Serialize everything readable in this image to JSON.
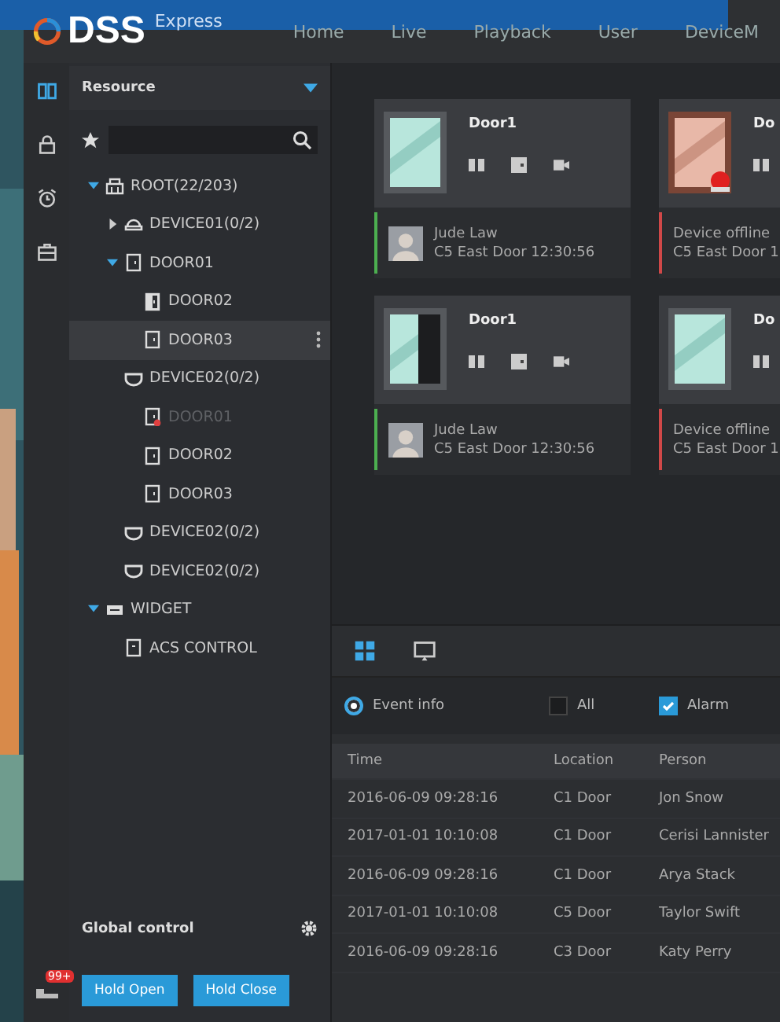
{
  "header": {
    "logo": "DSS",
    "edition": "Express",
    "nav": [
      {
        "label": "Home"
      },
      {
        "label": "Live"
      },
      {
        "label": "Playback"
      },
      {
        "label": "User"
      },
      {
        "label": "DeviceM"
      }
    ]
  },
  "rail": [
    {
      "kind": "book",
      "selected": true
    },
    {
      "kind": "lock",
      "selected": false
    },
    {
      "kind": "alarm",
      "selected": false
    },
    {
      "kind": "briefcase",
      "selected": false
    }
  ],
  "rail_badge": "99+",
  "sidebar": {
    "title": "Resource",
    "tree": [
      {
        "label": "ROOT(22/203)",
        "kind": "root",
        "expanded": true,
        "selected": false,
        "offline": false,
        "children": [
          {
            "label": "DEVICE01(0/2)",
            "kind": "device",
            "expanded": false,
            "selected": false,
            "offline": false
          },
          {
            "label": "DOOR01",
            "kind": "door",
            "expanded": true,
            "selected": false,
            "offline": false,
            "children": [
              {
                "label": "DOOR02",
                "kind": "door-open",
                "selected": false,
                "offline": false
              },
              {
                "label": "DOOR03",
                "kind": "door",
                "selected": true,
                "offline": false
              }
            ]
          },
          {
            "label": "DEVICE02(0/2)",
            "kind": "device2",
            "selected": false,
            "offline": false,
            "children": [
              {
                "label": "DOOR01",
                "kind": "door",
                "selected": false,
                "offline": true
              },
              {
                "label": "DOOR02",
                "kind": "door",
                "selected": false,
                "offline": false
              },
              {
                "label": "DOOR03",
                "kind": "door",
                "selected": false,
                "offline": false
              }
            ]
          },
          {
            "label": "DEVICE02(0/2)",
            "kind": "device2",
            "selected": false,
            "offline": false
          },
          {
            "label": "DEVICE02(0/2)",
            "kind": "device2",
            "selected": false,
            "offline": false
          }
        ]
      },
      {
        "label": "WIDGET",
        "kind": "widget",
        "expanded": true,
        "selected": false,
        "offline": false,
        "children": [
          {
            "label": "ACS CONTROL",
            "kind": "control",
            "selected": false,
            "offline": false
          }
        ]
      }
    ],
    "global_control": {
      "title": "Global control",
      "buttons": [
        "Hold Open",
        "Hold Close"
      ]
    }
  },
  "cards": [
    {
      "title": "Door1",
      "kind": "closed",
      "actions": [
        {
          "kind": "open"
        },
        {
          "kind": "door"
        },
        {
          "kind": "camera"
        }
      ],
      "color": "#4caf50",
      "person": "Jude Law",
      "detail": "C5 East Door  12:30:56"
    },
    {
      "title": "Do",
      "kind": "alarm",
      "actions": [
        {
          "kind": "open"
        }
      ],
      "color": "#d04848",
      "status": "Device offline",
      "detail": "C5 East Door  1"
    },
    {
      "title": "Door1",
      "kind": "open",
      "actions": [
        {
          "kind": "open"
        },
        {
          "kind": "door"
        },
        {
          "kind": "camera"
        }
      ],
      "color": "#4caf50",
      "person": "Jude Law",
      "detail": "C5 East Door  12:30:56"
    },
    {
      "title": "Do",
      "kind": "closed",
      "actions": [
        {
          "kind": "open"
        }
      ],
      "color": "#d04848",
      "status": "Device offline",
      "detail": "C5 East Door  1"
    }
  ],
  "views": [
    {
      "kind": "grid",
      "selected": true
    },
    {
      "kind": "screen",
      "selected": false
    }
  ],
  "filters": [
    {
      "kind": "radio",
      "label": "Event info",
      "selected": true
    },
    {
      "kind": "checkbox",
      "label": "All",
      "checked": false
    },
    {
      "kind": "checkbox",
      "label": "Alarm",
      "checked": true
    }
  ],
  "table": {
    "columns": [
      "Time",
      "Location",
      "Person"
    ],
    "rows": [
      [
        "2016-06-09  09:28:16",
        "C1 Door",
        "Jon Snow"
      ],
      [
        "2017-01-01  10:10:08",
        "C1 Door",
        "Cerisi Lannister"
      ],
      [
        "2016-06-09  09:28:16",
        "C1 Door",
        "Arya Stack"
      ],
      [
        "2017-01-01  10:10:08",
        "C5 Door",
        "Taylor Swift"
      ],
      [
        "2016-06-09  09:28:16",
        "C3 Door",
        "Katy Perry"
      ]
    ]
  }
}
